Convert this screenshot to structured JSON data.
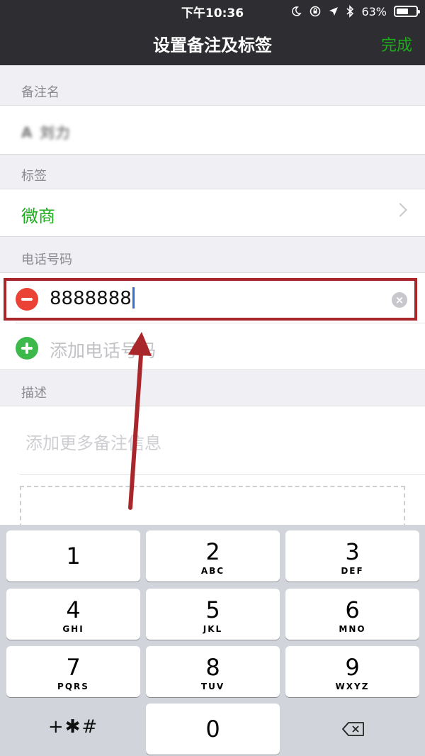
{
  "status": {
    "time": "下午10:36",
    "battery": "63%",
    "battery_level": 0.63
  },
  "nav": {
    "title": "设置备注及标签",
    "done": "完成"
  },
  "remark": {
    "label": "备注名",
    "value": "A 刘力"
  },
  "tags": {
    "label": "标签",
    "value": "微商"
  },
  "phone": {
    "label": "电话号码",
    "value": "8888888",
    "add_placeholder": "添加电话号码"
  },
  "description": {
    "label": "描述",
    "placeholder": "添加更多备注信息"
  },
  "keypad": {
    "keys": [
      {
        "num": "1",
        "letters": ""
      },
      {
        "num": "2",
        "letters": "ABC"
      },
      {
        "num": "3",
        "letters": "DEF"
      },
      {
        "num": "4",
        "letters": "GHI"
      },
      {
        "num": "5",
        "letters": "JKL"
      },
      {
        "num": "6",
        "letters": "MNO"
      },
      {
        "num": "7",
        "letters": "PQRS"
      },
      {
        "num": "8",
        "letters": "TUV"
      },
      {
        "num": "9",
        "letters": "WXYZ"
      },
      {
        "num": "0",
        "letters": ""
      }
    ],
    "symbols": "+✱#"
  },
  "colors": {
    "accent": "#1aad19",
    "highlight": "#a9272a",
    "nav_bg": "#2e2e32"
  },
  "icons": {
    "moon": "moon-icon",
    "rotation_lock": "rotation-lock-icon",
    "location": "location-arrow-icon",
    "bluetooth": "bluetooth-icon",
    "battery": "battery-icon",
    "chevron": "chevron-right-icon",
    "minus": "remove-circle-icon",
    "clear": "clear-circle-icon",
    "plus": "add-circle-icon",
    "backspace": "backspace-icon"
  }
}
